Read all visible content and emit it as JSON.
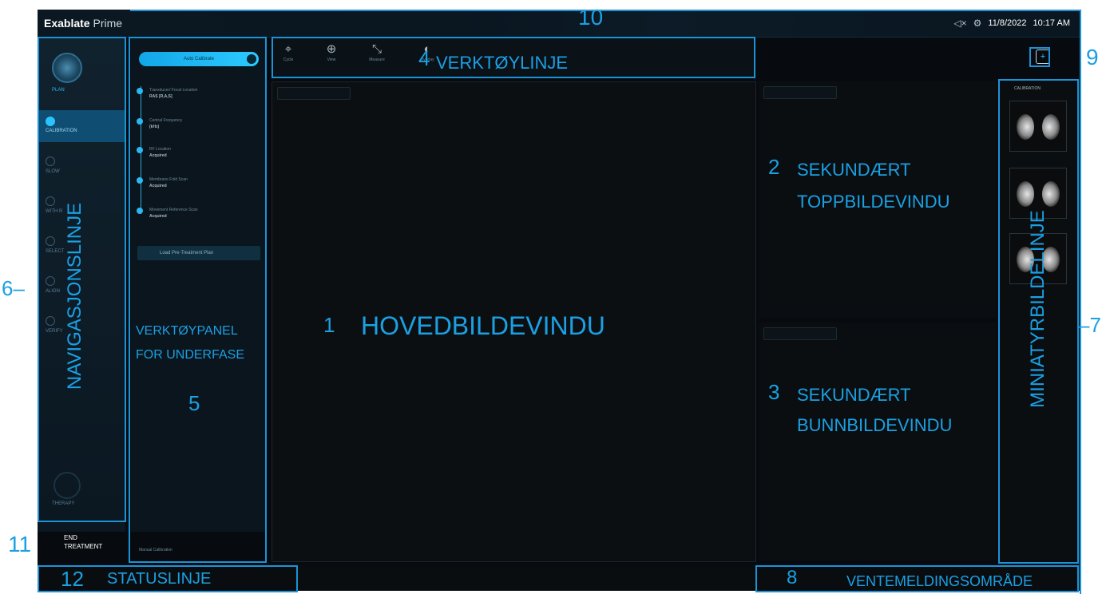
{
  "app": {
    "brand_bold": "Exablate",
    "brand_light": "Prime"
  },
  "header": {
    "date": "11/8/2022",
    "time": "10:17 AM",
    "mute_icon": "mute-icon",
    "settings_icon": "gear-icon"
  },
  "nav": {
    "items": [
      {
        "label": "PLAN"
      },
      {
        "label": "CALIBRATION"
      },
      {
        "label": "SLOW"
      },
      {
        "label": "WITH R"
      },
      {
        "label": "SELECT"
      },
      {
        "label": "ALIGN"
      },
      {
        "label": "VERIFY"
      },
      {
        "label": "THERAPY"
      }
    ],
    "end_treatment": "END\nTREATMENT"
  },
  "subphase": {
    "auto_calibrate": "Auto Calibrate",
    "steps": [
      {
        "title": "Transducer/ Focal Location",
        "value": "RAS [R,A,S]"
      },
      {
        "title": "Central Frequency",
        "value": "(kHz)"
      },
      {
        "title": "RF Location",
        "value": "Acquired"
      },
      {
        "title": "Membrane Fold Scan",
        "value": "Acquired"
      },
      {
        "title": "Movement Reference Scan",
        "value": "Acquired"
      }
    ],
    "load_button": "Load Pre-Treatment Plan",
    "manual_calibration": "Manual Calibration"
  },
  "toolbar": {
    "tools": [
      {
        "label": "Cycle",
        "icon": "cycle-icon"
      },
      {
        "label": "View",
        "icon": "zoom-icon"
      },
      {
        "label": "Measure",
        "icon": "measure-icon"
      },
      {
        "label": "Overlay",
        "icon": "overlay-icon"
      }
    ]
  },
  "thumbnails": {
    "header": "CALIBRATION",
    "count": 3
  },
  "annotations": {
    "n1": "1",
    "main_view": "HOVEDBILDEVINDU",
    "n2": "2",
    "sec_top_1": "SEKUNDÆRT",
    "sec_top_2": "TOPPBILDEVINDU",
    "n3": "3",
    "sec_bot_1": "SEKUNDÆRT",
    "sec_bot_2": "BUNNBILDEVINDU",
    "n4": "4",
    "toolbar": "VERKTØYLINJE",
    "n5": "5",
    "subpanel_1": "VERKTØYPANEL",
    "subpanel_2": "FOR UNDERFASE",
    "n6": "6–",
    "nav": "NAVIGASJONSLINJE",
    "n7": "–7",
    "thumbs": "MINIATYRBILDELINJE",
    "n8": "8",
    "pending": "VENTEMELDINGSOMRÅDE",
    "n9": "9",
    "n10": "10",
    "n11": "11",
    "n12": "12",
    "status": "STATUSLINJE"
  }
}
